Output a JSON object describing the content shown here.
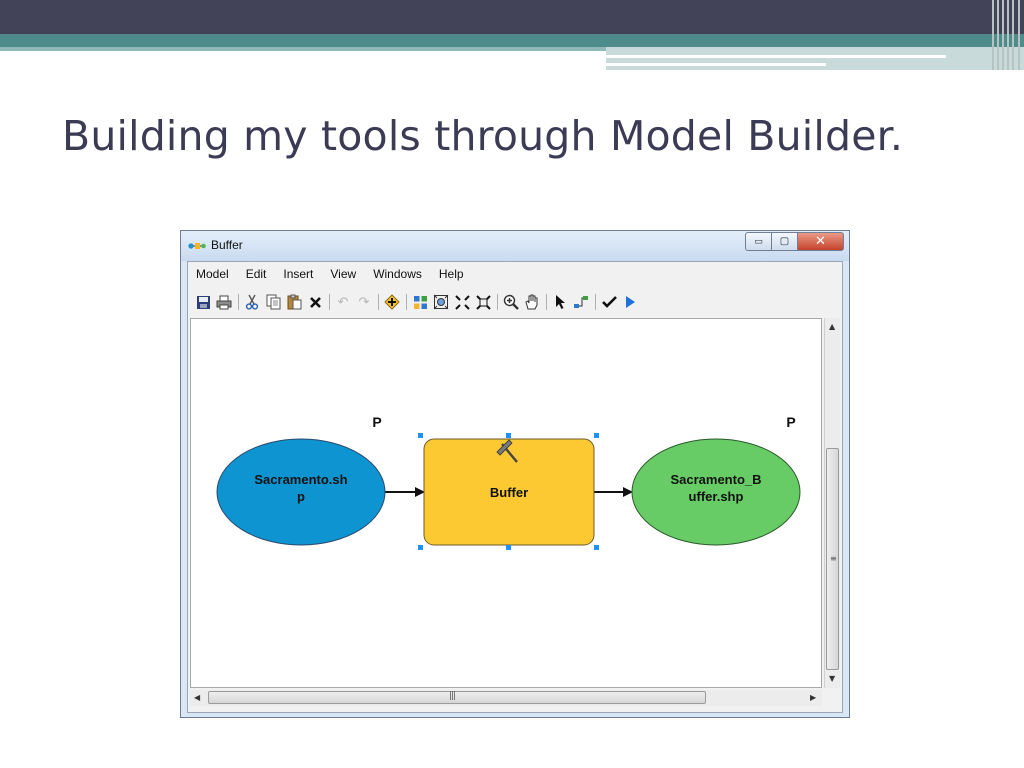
{
  "slide": {
    "title": "Building my tools through Model Builder."
  },
  "window": {
    "title": "Buffer",
    "controls": {
      "minimize": "▭",
      "maximize": "▢",
      "close": "✕"
    }
  },
  "menu": [
    "Model",
    "Edit",
    "Insert",
    "View",
    "Windows",
    "Help"
  ],
  "toolbar": {
    "icons": [
      "save-icon",
      "print-icon",
      "cut-icon",
      "copy-icon",
      "paste-icon",
      "delete-icon",
      "undo-icon",
      "redo-icon",
      "add-data-icon",
      "auto-layout-icon",
      "full-extent-icon",
      "zoom-in-fixed-icon",
      "zoom-out-fixed-icon",
      "zoom-in-icon",
      "pan-icon",
      "select-icon",
      "connect-icon",
      "validate-icon",
      "run-icon"
    ]
  },
  "diagram": {
    "input": {
      "label_line1": "Sacramento.sh",
      "label_line2": "p",
      "color": "#0d94d1",
      "parameter": "P"
    },
    "tool": {
      "label": "Buffer",
      "color": "#fdc933"
    },
    "output": {
      "label_line1": "Sacramento_B",
      "label_line2": "uffer.shp",
      "color": "#67cc66",
      "parameter": "P"
    }
  },
  "colors": {
    "title_text": "#3b3b55",
    "band_dark": "#424258",
    "band_teal": "#4e8c8c",
    "selection_handle": "#1e90ff"
  }
}
